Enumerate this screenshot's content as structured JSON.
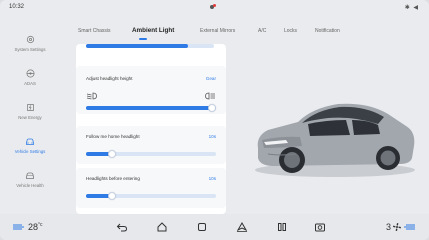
{
  "status": {
    "time": "10:32",
    "right_icons": "✱ ◀"
  },
  "sidebar": {
    "items": [
      {
        "label": "System Settings",
        "icon": "gear-icon",
        "active": false
      },
      {
        "label": "ADAS",
        "icon": "steering-wheel-icon",
        "active": false
      },
      {
        "label": "New Energy",
        "icon": "battery-icon",
        "active": false
      },
      {
        "label": "Vehicle Settings",
        "icon": "car-icon",
        "active": true
      },
      {
        "label": "Vehicle Health",
        "icon": "car-health-icon",
        "active": false
      }
    ]
  },
  "tabs": [
    {
      "label": "Smart Chassis",
      "active": false
    },
    {
      "label": "Ambient Light",
      "active": true
    },
    {
      "label": "External Mirrors",
      "active": false
    },
    {
      "label": "A/C",
      "active": false
    },
    {
      "label": "Locks",
      "active": false
    },
    {
      "label": "Notification",
      "active": false
    }
  ],
  "panel": {
    "top_slider_level": 0.8,
    "headlight_height": {
      "title": "Adjust headlight height",
      "value": "Gear",
      "level": 1.0
    },
    "follow_me_home": {
      "title": "Follow me home headlight",
      "value": "10s",
      "level": 0.2
    },
    "before_entering": {
      "title": "Headlights before entering",
      "value": "10s",
      "level": 0.2
    }
  },
  "bottom": {
    "left_temp": "28",
    "left_unit": "°c",
    "right_temp": "3",
    "accent": "#2f7be6"
  }
}
